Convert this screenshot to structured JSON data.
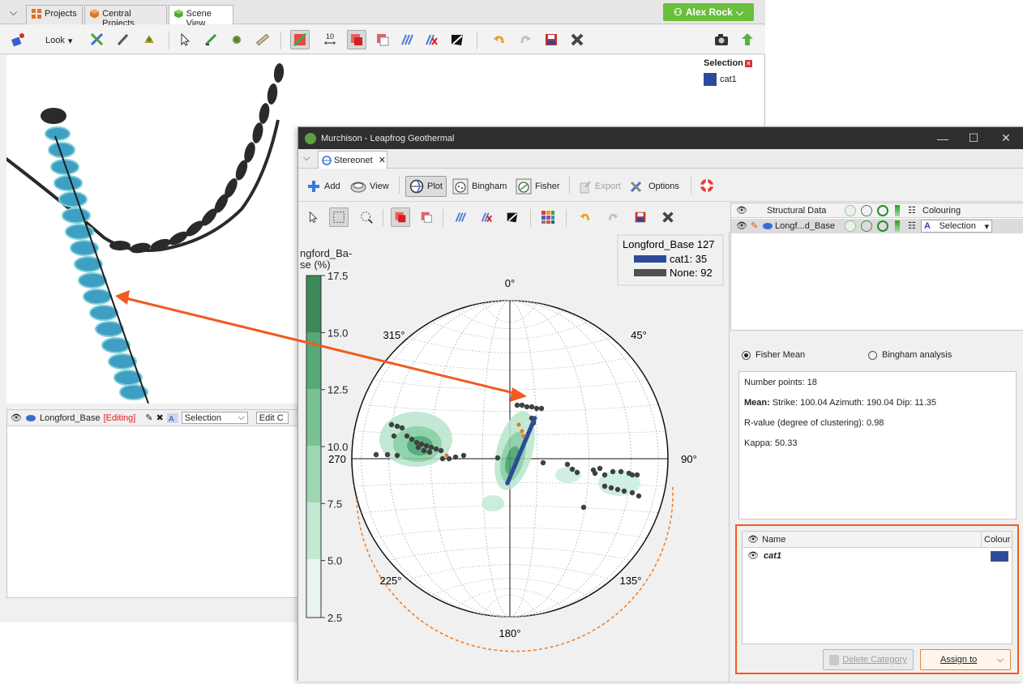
{
  "back_window": {
    "tabs": [
      {
        "label": "Projects"
      },
      {
        "label": "Central Projects"
      },
      {
        "label": "Scene View"
      }
    ],
    "user_label": "Alex Rock",
    "look_label": "Look",
    "scale_label": "10",
    "selection_legend": {
      "title": "Selection",
      "items": [
        {
          "label": "cat1",
          "color": "#2e4a9a"
        }
      ]
    },
    "lower_panel": {
      "object_label": "Longford_Base",
      "editing_label": "[Editing]",
      "colouring_value": "Selection",
      "edit_button": "Edit C"
    }
  },
  "front_window": {
    "title": "Murchison - Leapfrog Geothermal",
    "tab_label": "Stereonet",
    "toolbar": {
      "add": "Add",
      "view": "View",
      "plot": "Plot",
      "bingham": "Bingham",
      "fisher": "Fisher",
      "export": "Export",
      "options": "Options"
    },
    "structural_table": {
      "headers": {
        "structural_data": "Structural Data",
        "colouring": "Colouring"
      },
      "row": {
        "name": "Longf...d_Base",
        "colouring": "Selection"
      }
    },
    "analysis": {
      "fisher_label": "Fisher Mean",
      "bingham_label": "Bingham analysis",
      "selected": "fisher",
      "number_points": "Number points: 18",
      "mean_label": "Mean:",
      "mean_values": "Strike: 100.04 Azimuth: 190.04  Dip: 11.35",
      "r_value": "R-value (degree of clustering): 0.98",
      "kappa": "Kappa: 50.33"
    },
    "categories": {
      "headers": {
        "name": "Name",
        "colour": "Colour"
      },
      "rows": [
        {
          "name": "cat1",
          "color": "#2e4a9a"
        }
      ],
      "delete_button": "Delete Category",
      "assign_button": "Assign to"
    }
  },
  "chart_data": {
    "type": "scatter",
    "colorbar": {
      "label_line1": "ngford_Ba-",
      "label_line2": "se (%)",
      "ticks": [
        "17.5",
        "15.0",
        "12.5",
        "10.0",
        "7.5",
        "5.0",
        "2.5"
      ],
      "range": [
        2.5,
        17.5
      ]
    },
    "legend": {
      "title": "Longford_Base 127",
      "position": "top-right",
      "entries": [
        {
          "label": "cat1: 35",
          "color": "#2e4a9a"
        },
        {
          "label": "None: 92",
          "color": "#505050"
        }
      ]
    },
    "direction_labels": {
      "n": "0°",
      "ne": "45°",
      "e": "90°",
      "se": "135°",
      "s": "180°",
      "sw": "225°",
      "w": "270",
      "nw": "315°"
    },
    "grid": true,
    "colors": {
      "density": "#3c9e6a",
      "selection_circle": "#f07a1e"
    }
  }
}
